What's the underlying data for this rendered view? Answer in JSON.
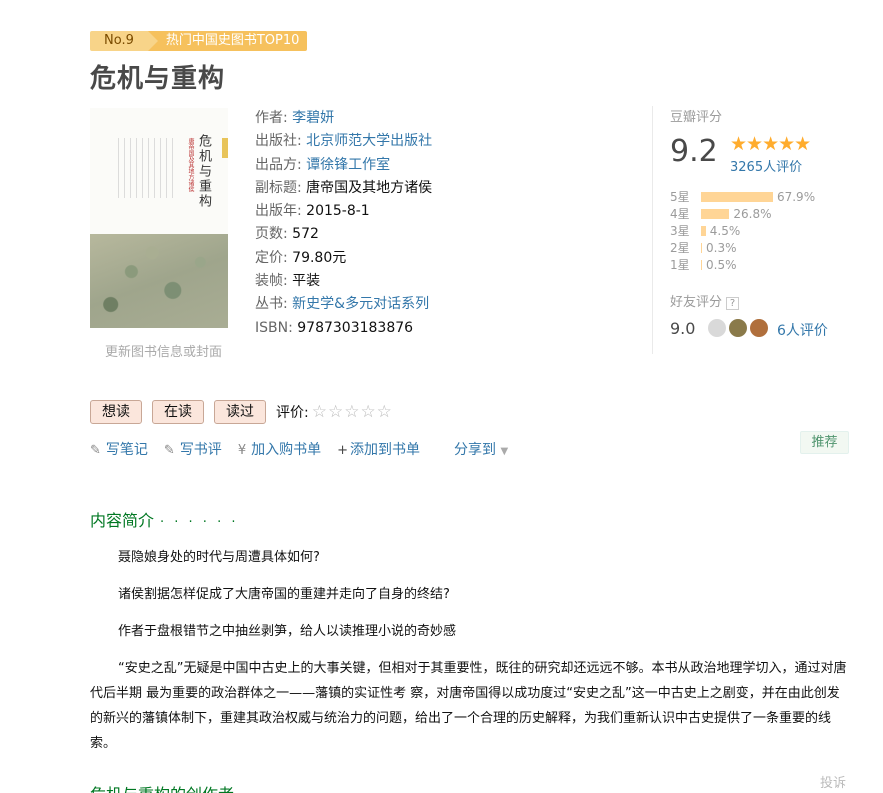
{
  "badge": {
    "rank": "No.9",
    "category": "热门中国史图书TOP10"
  },
  "title": "危机与重构",
  "cover": {
    "vertical_title": "危机与重构",
    "vertical_subtitle": "唐帝国及其地方诸侯",
    "update_link": "更新图书信息或封面"
  },
  "info": [
    {
      "label": "作者:",
      "value": "李碧妍",
      "link": true
    },
    {
      "label": "出版社:",
      "value": "北京师范大学出版社",
      "link": true
    },
    {
      "label": "出品方:",
      "value": "谭徐锋工作室",
      "link": true
    },
    {
      "label": "副标题:",
      "value": "唐帝国及其地方诸侯",
      "link": false
    },
    {
      "label": "出版年:",
      "value": "2015-8-1",
      "link": false
    },
    {
      "label": "页数:",
      "value": "572",
      "link": false
    },
    {
      "label": "定价:",
      "value": "79.80元",
      "link": false
    },
    {
      "label": "装帧:",
      "value": "平装",
      "link": false
    },
    {
      "label": "丛书:",
      "value": "新史学&多元对话系列",
      "link": true
    },
    {
      "label": "ISBN:",
      "value": "9787303183876",
      "link": false
    }
  ],
  "rating": {
    "header": "豆瓣评分",
    "score": "9.2",
    "stars": "★★★★★",
    "count": "3265人评价",
    "distribution": [
      {
        "label": "5星",
        "pct": "67.9%",
        "value": 67.9
      },
      {
        "label": "4星",
        "pct": "26.8%",
        "value": 26.8
      },
      {
        "label": "3星",
        "pct": "4.5%",
        "value": 4.5
      },
      {
        "label": "2星",
        "pct": "0.3%",
        "value": 0.3
      },
      {
        "label": "1星",
        "pct": "0.5%",
        "value": 0.5
      }
    ],
    "friend_header": "好友评分",
    "friend_help": "?",
    "friend_score": "9.0",
    "friend_count": "6人评价",
    "avatar_colors": [
      "#d9d9d9",
      "#8a7a4a",
      "#b06f3c"
    ]
  },
  "actions": {
    "want": "想读",
    "reading": "在读",
    "read": "读过",
    "rate_label": "评价:",
    "rate_stars": "☆☆☆☆☆"
  },
  "links": {
    "note": "写笔记",
    "review": "写书评",
    "cart": "加入购书单",
    "list": "添加到书单",
    "share": "分享到",
    "recommend": "推荐"
  },
  "intro": {
    "title": "内容简介",
    "dots": "· · · · · ·",
    "paragraphs": [
      "聂隐娘身处的时代与周遭具体如何?",
      "诸侯割据怎样促成了大唐帝国的重建并走向了自身的终结?",
      "作者于盘根错节之中抽丝剥笋，给人以读推理小说的奇妙感",
      "“安史之乱”无疑是中国中古史上的大事关键，但相对于其重要性，既往的研究却还远远不够。本书从政治地理学切入，通过对唐代后半期 最为重要的政治群体之一——藩镇的实证性考 察，对唐帝国得以成功度过“安史之乱”这一中古史上之剧变，并在由此创发的新兴的藩镇体制下，重建其政治权威与统治力的问题，给出了一个合理的历史解释，为我们重新认识中古史提供了一条重要的线索。"
    ]
  },
  "section2": "危机与重构的创作者",
  "report": "投诉"
}
